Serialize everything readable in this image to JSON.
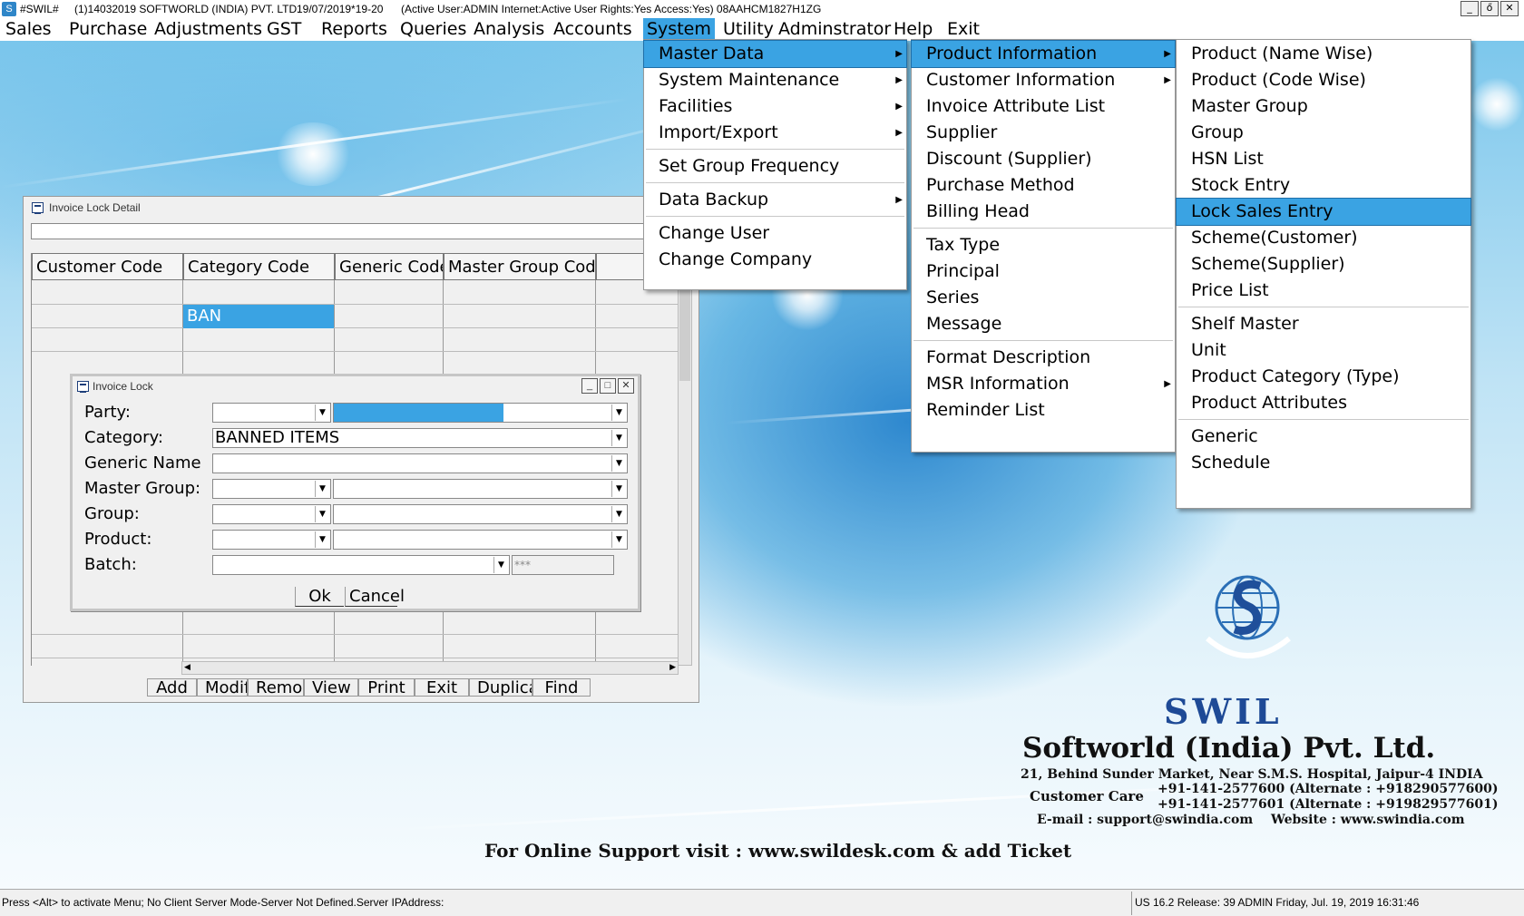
{
  "titlebar": {
    "app_name": "#SWIL#",
    "company": "(1)14032019 SOFTWORLD (INDIA) PVT. LTD.",
    "period": "19/07/2019*19-20",
    "status": "(Active User:ADMIN Internet:Active  User Rights:Yes Access:Yes) 08AAHCM1827H1ZG",
    "minimize": "_",
    "restore": "ő",
    "close": "✕"
  },
  "menubar": [
    "Sales",
    "Purchase",
    "Adjustments",
    "GST",
    "Reports",
    "Queries",
    "Analysis",
    "Accounts",
    "System",
    "Utility",
    "Adminstrator",
    "Help",
    "Exit"
  ],
  "system_menu": {
    "items": [
      "Master Data",
      "System Maintenance",
      "Facilities",
      "Import/Export",
      "Set Group Frequency",
      "Data Backup",
      "Change User",
      "Change Company"
    ]
  },
  "master_data_menu": {
    "items": [
      "Product Information",
      "Customer Information",
      "Invoice Attribute List",
      "Supplier",
      "Discount (Supplier)",
      "Purchase Method",
      "Billing Head",
      "Tax Type",
      "Principal",
      "Series",
      "Message",
      "Format Description",
      "MSR Information",
      "Reminder List"
    ]
  },
  "product_info_menu": {
    "items": [
      "Product (Name Wise)",
      "Product (Code Wise)",
      "Master Group",
      "Group",
      "HSN List",
      "Stock Entry",
      "Lock Sales Entry",
      "Scheme(Customer)",
      "Scheme(Supplier)",
      "Price List",
      "Shelf Master",
      "Unit",
      "Product Category (Type)",
      "Product Attributes",
      "Generic",
      "Schedule"
    ]
  },
  "detail_window": {
    "title": "Invoice Lock Detail",
    "columns": [
      "Customer Code",
      "Category Code",
      "Generic Code",
      "Master Group Code"
    ],
    "selected_cell": "BAN",
    "buttons": [
      "Add",
      "Modify",
      "Remove",
      "View",
      "Print",
      "Exit",
      "Duplicate",
      "Find"
    ]
  },
  "lock_dialog": {
    "title": "Invoice Lock",
    "labels": [
      "Party:",
      "Category:",
      "Generic Name",
      "Master Group:",
      "Group:",
      "Product:",
      "Batch:"
    ],
    "category_value": "BANNED ITEMS",
    "batch_mask": "***",
    "ok": "Ok",
    "cancel": "Cancel"
  },
  "branding": {
    "logo_text": "SWIL",
    "company": "Softworld (India) Pvt. Ltd.",
    "address": "21, Behind Sunder Market, Near S.M.S. Hospital, Jaipur-4 INDIA",
    "customer_care_label": "Customer Care",
    "phone1": "+91-141-2577600 (Alternate : +918290577600)",
    "phone2": "+91-141-2577601 (Alternate : +919829577601)",
    "email": "E-mail : support@swindia.com",
    "website": "Website : www.swindia.com",
    "support": "For Online Support visit : www.swildesk.com & add Ticket"
  },
  "statusbar": {
    "left": "Press <Alt> to activate Menu; No Client Server Mode-Server Not Defined.Server IPAddress:",
    "right": "US 16.2 Release: 39  ADMIN  Friday, Jul. 19, 2019  16:31:46"
  },
  "colors": {
    "accent": "#3aa3e3",
    "window_bg": "#f0f0f0"
  }
}
